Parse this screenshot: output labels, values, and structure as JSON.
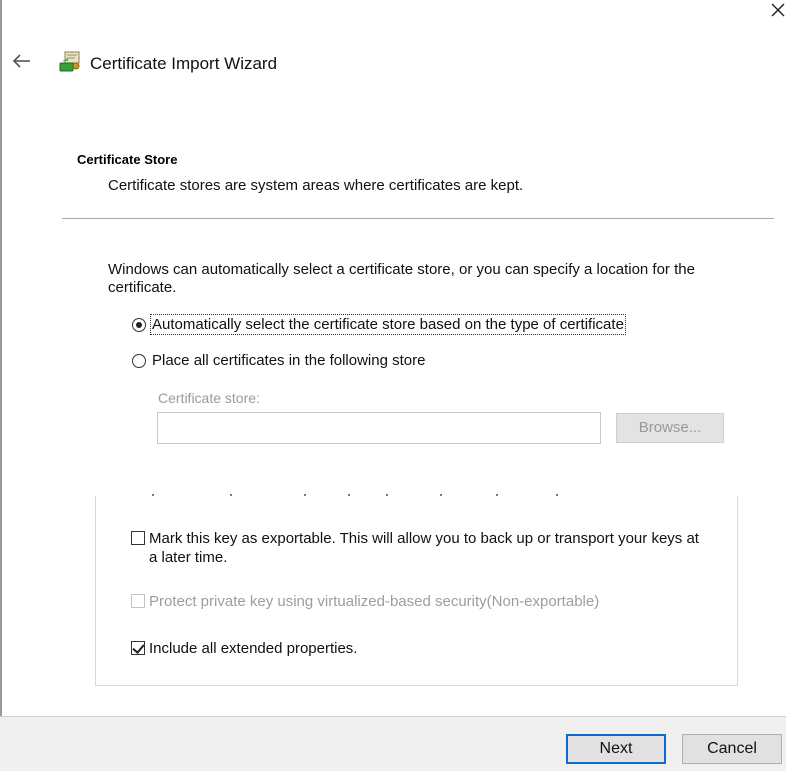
{
  "window": {
    "title": "Certificate Import Wizard",
    "close_glyph": "✕",
    "back_glyph": "←",
    "icon": "certificate-wizard-icon"
  },
  "header": {
    "heading": "Certificate Store",
    "description": "Certificate stores are system areas where certificates are kept."
  },
  "body": {
    "intro": "Windows can automatically select a certificate store, or you can specify a location for the certificate.",
    "radio_auto": {
      "label": "Automatically select the certificate store based on the type of certificate",
      "checked": true
    },
    "radio_manual": {
      "label": "Place all certificates in the following store",
      "checked": false
    },
    "store_label": "Certificate store:",
    "store_value": "",
    "browse_label": "Browse..."
  },
  "options": {
    "exportable": {
      "label": "Mark this key as exportable. This will allow you to back up or transport your keys at a later time.",
      "checked": false
    },
    "vbs": {
      "label": "Protect private key using virtualized-based security(Non-exportable)",
      "checked": false,
      "disabled": true
    },
    "extended": {
      "label": "Include all extended properties.",
      "checked": true
    }
  },
  "footer": {
    "next_label": "Next",
    "cancel_label": "Cancel"
  },
  "colors": {
    "accent": "#0a6ed1",
    "footer_bg": "#f0f0f0",
    "disabled_text": "#9d9d9d"
  }
}
